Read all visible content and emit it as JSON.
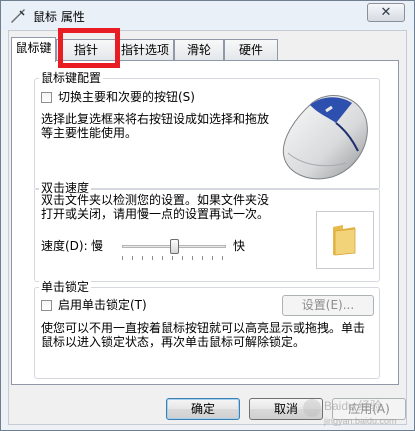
{
  "window": {
    "title": "鼠标 属性",
    "close_glyph": "✕"
  },
  "tabs": [
    {
      "label": "鼠标键",
      "active": true
    },
    {
      "label": "指针",
      "active": false
    },
    {
      "label": "指针选项",
      "active": false
    },
    {
      "label": "滑轮",
      "active": false
    },
    {
      "label": "硬件",
      "active": false
    }
  ],
  "button_config": {
    "title": "鼠标键配置",
    "switch_label": "切换主要和次要的按钮(S)",
    "switch_checked": false,
    "description_line1": "选择此复选框来将右按钮设成如选择和拖放",
    "description_line2": "等主要性能使用。"
  },
  "double_click": {
    "title": "双击速度",
    "description_line1": "双击文件夹以检测您的设置。如果文件夹没",
    "description_line2": "打开或关闭，请用慢一点的设置再试一次。",
    "speed_label": "速度(D):",
    "slow_label": "慢",
    "fast_label": "快",
    "speed_value_fraction": 0.5
  },
  "click_lock": {
    "title": "单击锁定",
    "enable_label": "启用单击锁定(T)",
    "enable_checked": false,
    "settings_button": "设置(E)...",
    "description_line1": "使您可以不用一直按着鼠标按钮就可以高亮显示或拖拽。单击",
    "description_line2": "鼠标以进入锁定状态，再次单击鼠标可解除锁定。"
  },
  "footer": {
    "ok": "确定",
    "cancel": "取消",
    "apply": "应用(A)"
  },
  "watermark": {
    "text": "Baidu 经验",
    "url": "jingyan.baidu.com"
  },
  "colors": {
    "highlight": "#e81c22",
    "folder": "#f3d37a",
    "accent": "#3c7fb1"
  }
}
